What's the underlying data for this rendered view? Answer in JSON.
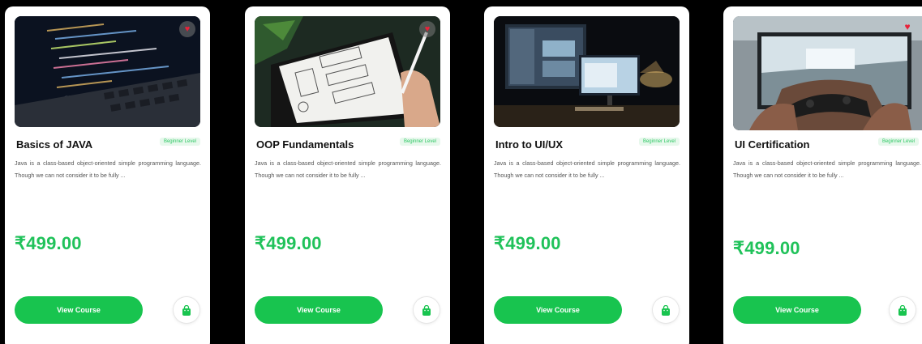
{
  "colors": {
    "accent": "#18c44f",
    "price": "#20c25a",
    "badge_bg": "#e7f8ec",
    "favorite": "#e8223a"
  },
  "courses": [
    {
      "title": "Basics of JAVA",
      "level": "Beginner Level",
      "description": "Java is a class-based object-oriented simple programming language. Though we can not consider it to be fully ...",
      "price": "₹499.00",
      "cta": "View Course",
      "image": "laptop-code-photo",
      "favorite_icon": "heart-icon"
    },
    {
      "title": "OOP Fundamentals",
      "level": "Beginner Level",
      "description": "Java is a class-based object-oriented simple programming language. Though we can not consider it to be fully ...",
      "price": "₹499.00",
      "cta": "View Course",
      "image": "tablet-sketch-photo",
      "favorite_icon": "heart-icon"
    },
    {
      "title": "Intro to UI/UX",
      "level": "Beginner Level",
      "description": "Java is a class-based object-oriented simple programming language. Though we can not consider it to be fully ...",
      "price": "₹499.00",
      "cta": "View Course",
      "image": "desk-monitors-photo",
      "favorite_icon": null
    },
    {
      "title": "UI Certification",
      "level": "Beginner Level",
      "description": "Java is a class-based object-oriented simple programming language. Though we can not consider it to be fully ...",
      "price": "₹499.00",
      "cta": "View Course",
      "image": "gaming-controller-photo",
      "favorite_icon": "heart-icon"
    }
  ]
}
